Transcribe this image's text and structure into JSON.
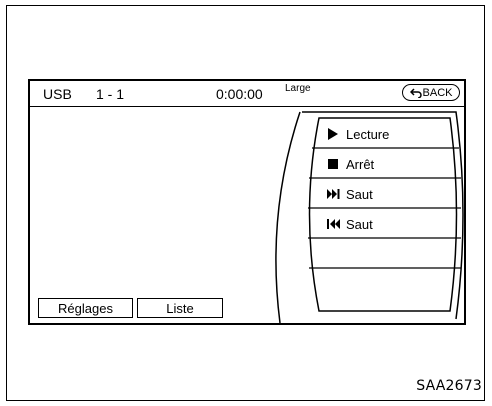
{
  "status_bar": {
    "source": "USB",
    "track": "1 - 1",
    "time": "0:00:00",
    "mode": "Large",
    "back_label": "BACK"
  },
  "menu": {
    "items": [
      {
        "label": "Lecture",
        "icon": "play-icon"
      },
      {
        "label": "Arrêt",
        "icon": "stop-icon"
      },
      {
        "label": "Saut",
        "icon": "skip-forward-icon"
      },
      {
        "label": "Saut",
        "icon": "skip-back-icon"
      }
    ]
  },
  "bottom_buttons": {
    "settings_label": "Réglages",
    "list_label": "Liste"
  },
  "caption": "SAA2673"
}
